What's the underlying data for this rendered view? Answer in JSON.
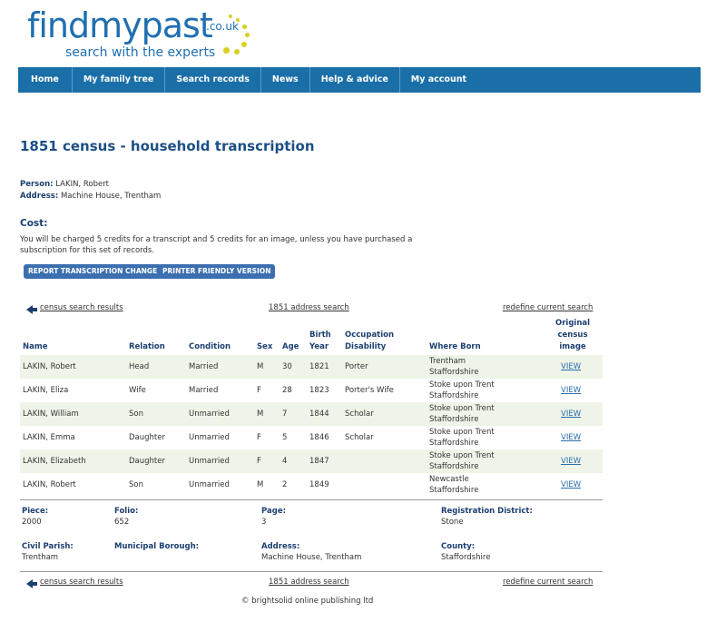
{
  "brand": {
    "name": "findmypast",
    "tld": ".co.uk",
    "tagline": "search with the experts"
  },
  "nav": [
    "Home",
    "My family tree",
    "Search records",
    "News",
    "Help & advice",
    "My account"
  ],
  "page_title": "1851 census - household transcription",
  "person": {
    "label": "Person:",
    "value": "LAKIN, Robert"
  },
  "address": {
    "label": "Address:",
    "value": "Machine House, Trentham"
  },
  "cost": {
    "heading": "Cost:",
    "line1": "You will be charged 5 credits for a transcript and 5 credits for an image, unless you have purchased a",
    "line2": "subscription for this set of records."
  },
  "buttons": {
    "report": "REPORT TRANSCRIPTION CHANGE",
    "printer": "PRINTER FRIENDLY VERSION"
  },
  "links": {
    "back": "census search results",
    "address_search": "1851 address search",
    "redefine": "redefine current search"
  },
  "table": {
    "headers": {
      "name": "Name",
      "relation": "Relation",
      "condition": "Condition",
      "sex": "Sex",
      "age": "Age",
      "birth_1": "Birth",
      "birth_2": "Year",
      "occ_1": "Occupation",
      "occ_2": "Disability",
      "born": "Where Born",
      "img_1": "Original",
      "img_2": "census",
      "img_3": "image"
    },
    "rows": [
      {
        "name": "LAKIN, Robert",
        "relation": "Head",
        "condition": "Married",
        "sex": "M",
        "age": "30",
        "year": "1821",
        "occupation": "Porter",
        "born_1": "Trentham",
        "born_2": "Staffordshire",
        "view": "VIEW"
      },
      {
        "name": "LAKIN, Eliza",
        "relation": "Wife",
        "condition": "Married",
        "sex": "F",
        "age": "28",
        "year": "1823",
        "occupation": "Porter's Wife",
        "born_1": "Stoke upon Trent",
        "born_2": "Staffordshire",
        "view": "VIEW"
      },
      {
        "name": "LAKIN, William",
        "relation": "Son",
        "condition": "Unmarried",
        "sex": "M",
        "age": "7",
        "year": "1844",
        "occupation": "Scholar",
        "born_1": "Stoke upon Trent",
        "born_2": "Staffordshire",
        "view": "VIEW"
      },
      {
        "name": "LAKIN, Emma",
        "relation": "Daughter",
        "condition": "Unmarried",
        "sex": "F",
        "age": "5",
        "year": "1846",
        "occupation": "Scholar",
        "born_1": "Stoke upon Trent",
        "born_2": "Staffordshire",
        "view": "VIEW"
      },
      {
        "name": "LAKIN, Elizabeth",
        "relation": "Daughter",
        "condition": "Unmarried",
        "sex": "F",
        "age": "4",
        "year": "1847",
        "occupation": "",
        "born_1": "Stoke upon Trent",
        "born_2": "Staffordshire",
        "view": "VIEW"
      },
      {
        "name": "LAKIN, Robert",
        "relation": "Son",
        "condition": "Unmarried",
        "sex": "M",
        "age": "2",
        "year": "1849",
        "occupation": "",
        "born_1": "Newcastle",
        "born_2": "Staffordshire",
        "view": "VIEW"
      }
    ]
  },
  "details": {
    "piece": {
      "label": "Piece:",
      "value": "2000"
    },
    "folio": {
      "label": "Folio:",
      "value": "652"
    },
    "page": {
      "label": "Page:",
      "value": "3"
    },
    "registration_district": {
      "label": "Registration District:",
      "value": "Stone"
    },
    "civil_parish": {
      "label": "Civil Parish:",
      "value": "Trentham"
    },
    "municipal_borough": {
      "label": "Municipal Borough:",
      "value": ""
    },
    "address": {
      "label": "Address:",
      "value": "Machine House, Trentham"
    },
    "county": {
      "label": "County:",
      "value": "Staffordshire"
    }
  },
  "footer": "© brightsolid online publishing ltd",
  "colors": {
    "nav_bg": "#1a6fa8",
    "title": "#1c4f86",
    "row_shade": "#eef5e8",
    "button": "#3b6fb0",
    "logo_dot": "#d8d020"
  }
}
